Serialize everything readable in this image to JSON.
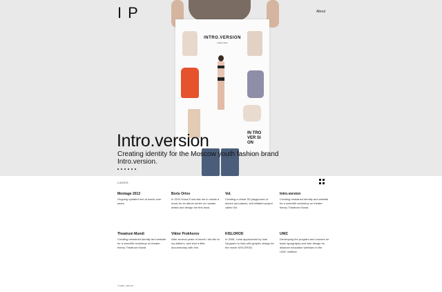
{
  "site": {
    "logo": "IP",
    "nav_about": "About"
  },
  "hero": {
    "title": "Intro.version",
    "description": "Creating identity for the Moscow youth fashion brand Intro.version.",
    "poster_title": "INTRO.VERSION",
    "poster_subtitle": "online store",
    "poster_logo": "IN TRO VER SI ON"
  },
  "cases": {
    "section_label": "CASES",
    "items": [
      {
        "title": "Montage 2013",
        "description": "Ongoing updated reel of works over years"
      },
      {
        "title": "Boris Orlov",
        "description": "In 2010 Kraus Fund ask me to create a mock for an album series on russian artists and design the first book."
      },
      {
        "title": "Vol.",
        "description": "Creating a virtual 3D playground of stones and places, self initiated project called Vol."
      },
      {
        "title": "Intro.version",
        "description": "Creating restrained identity and website for a scientific workshop on theater theory Theatrum Mundi."
      },
      {
        "title": "Theatrum Mundi",
        "description": "Creating restrained identity and website for a scientific workshop on theater theory Theatrum Mundi."
      },
      {
        "title": "Viktor Prokhorov",
        "description": "After several years of words I did site to my father's, and shot a little documentary with him."
      },
      {
        "title": "KISLOROD",
        "description": "In 2006, I was approached by Ivan Vyrypaev to help with graphic design for the movie KISLOROD."
      },
      {
        "title": "UNIC",
        "description": "Developing the program and courses on basic typography and web design for distance education webinars in the UNIC institute."
      }
    ]
  },
  "footer": {
    "copyright": "© 1984—2013 IP"
  },
  "colors": {
    "hero_bg": "#e9e9e9",
    "coat": "#e6512e",
    "jeans": "#4a5d7a"
  },
  "icons": [
    "grid-view-icon"
  ]
}
